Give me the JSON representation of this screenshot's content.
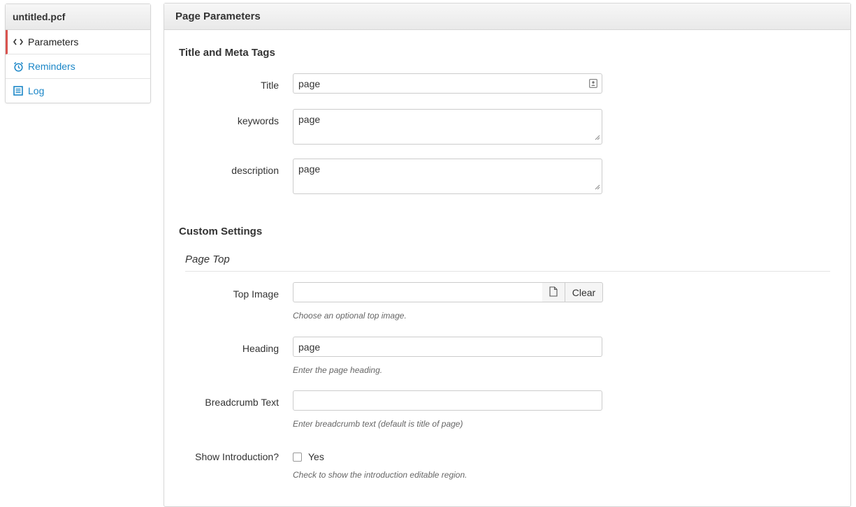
{
  "sidebar": {
    "title": "untitled.pcf",
    "items": [
      {
        "label": "Parameters",
        "icon": "code-icon"
      },
      {
        "label": "Reminders",
        "icon": "alarm-clock-icon"
      },
      {
        "label": "Log",
        "icon": "list-icon"
      }
    ]
  },
  "panel": {
    "title": "Page Parameters",
    "meta_section": {
      "title": "Title and Meta Tags",
      "title_label": "Title",
      "title_value": "page",
      "keywords_label": "keywords",
      "keywords_value": "page",
      "description_label": "description",
      "description_value": "page"
    },
    "custom_section": {
      "title": "Custom Settings",
      "subsection": "Page Top",
      "top_image_label": "Top Image",
      "top_image_value": "",
      "top_image_help": "Choose an optional top image.",
      "clear_label": "Clear",
      "heading_label": "Heading",
      "heading_value": "page",
      "heading_help": "Enter the page heading.",
      "breadcrumb_label": "Breadcrumb Text",
      "breadcrumb_value": "",
      "breadcrumb_help": "Enter breadcrumb text (default is title of page)",
      "intro_label": "Show Introduction?",
      "intro_option": "Yes",
      "intro_checked": false,
      "intro_help": "Check to show the introduction editable region."
    }
  },
  "colors": {
    "link": "#1a86c7",
    "active_marker": "#d9534f",
    "border": "#cccccc"
  }
}
